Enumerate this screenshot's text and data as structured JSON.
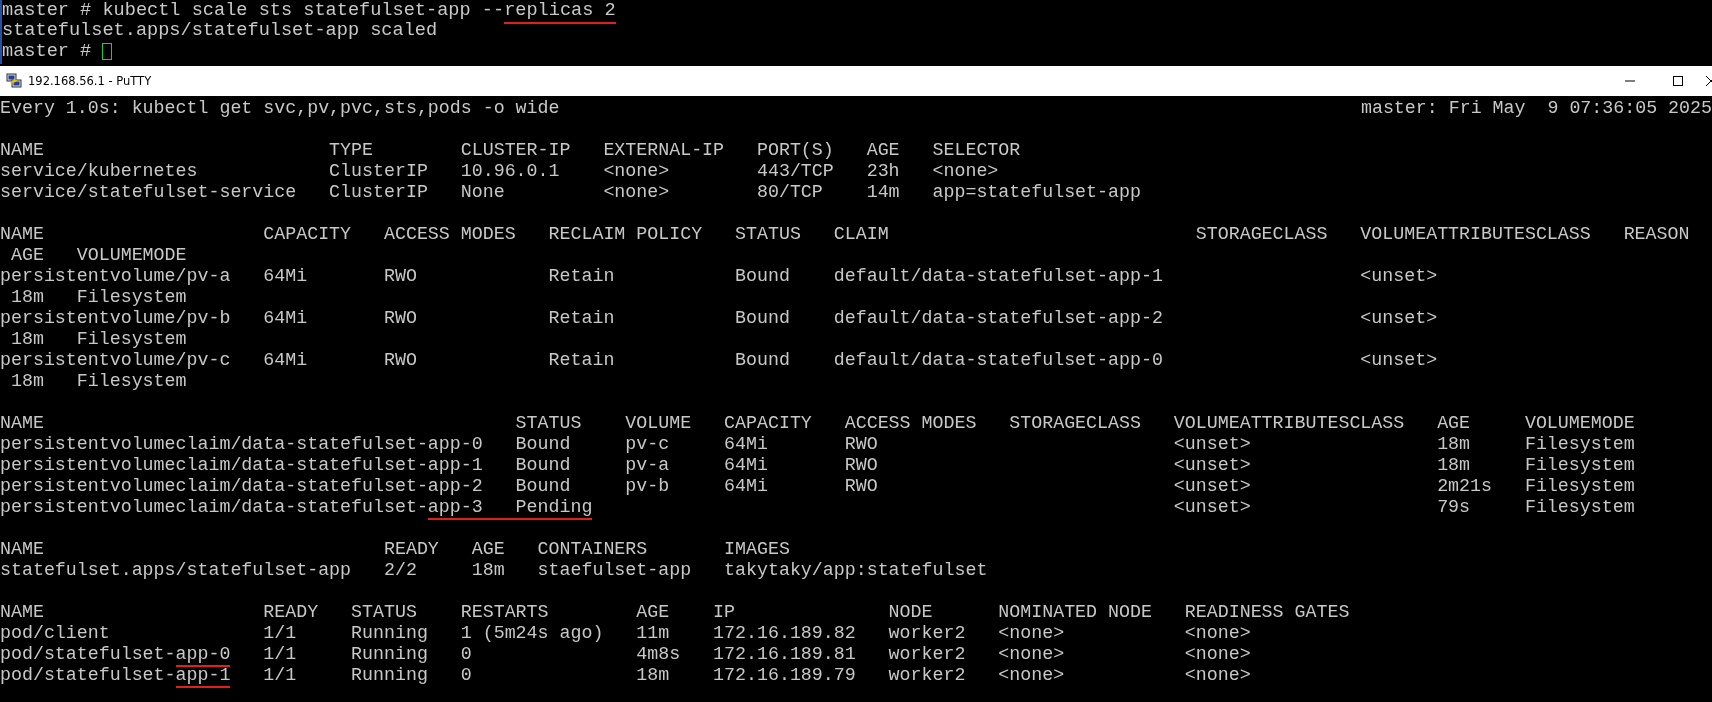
{
  "upper_terminal": {
    "lines": [
      [
        {
          "text": "master # kubectl scale sts statefulset-app --",
          "marked": false
        },
        {
          "text": "replicas 2",
          "marked": true
        }
      ],
      [
        {
          "text": "statefulset.apps/statefulset-app scaled",
          "marked": false
        }
      ],
      [
        {
          "text": "master # ",
          "marked": false
        }
      ]
    ],
    "cursor": true
  },
  "putty_window": {
    "title": "192.168.56.1 - PuTTY",
    "watch_header": {
      "command": "Every 1.0s: kubectl get svc,pv,pvc,sts,pods -o wide",
      "host_time": "master: Fri May  9 07:36:05 2025"
    },
    "blocks": [
      [
        [
          {
            "text": "NAME                          TYPE        CLUSTER-IP   EXTERNAL-IP   PORT(S)   AGE   SELECTOR",
            "marked": false
          }
        ],
        [
          {
            "text": "service/kubernetes            ClusterIP   10.96.0.1    <none>        443/TCP   23h   <none>",
            "marked": false
          }
        ],
        [
          {
            "text": "service/statefulset-service   ClusterIP   None         <none>        80/TCP    14m   app=statefulset-app",
            "marked": false
          }
        ]
      ],
      [
        [
          {
            "text": "NAME                    CAPACITY   ACCESS MODES   RECLAIM POLICY   STATUS   CLAIM                            STORAGECLASS   VOLUMEATTRIBUTESCLASS   REASON",
            "marked": false
          }
        ],
        [
          {
            "text": " AGE   VOLUMEMODE",
            "marked": false
          }
        ],
        [
          {
            "text": "persistentvolume/pv-a   64Mi       RWO            Retain           Bound    default/data-statefulset-app-1                  <unset>",
            "marked": false
          }
        ],
        [
          {
            "text": " 18m   Filesystem",
            "marked": false
          }
        ],
        [
          {
            "text": "persistentvolume/pv-b   64Mi       RWO            Retain           Bound    default/data-statefulset-app-2                  <unset>",
            "marked": false
          }
        ],
        [
          {
            "text": " 18m   Filesystem",
            "marked": false
          }
        ],
        [
          {
            "text": "persistentvolume/pv-c   64Mi       RWO            Retain           Bound    default/data-statefulset-app-0                  <unset>",
            "marked": false
          }
        ],
        [
          {
            "text": " 18m   Filesystem",
            "marked": false
          }
        ]
      ],
      [
        [
          {
            "text": "NAME                                           STATUS    VOLUME   CAPACITY   ACCESS MODES   STORAGECLASS   VOLUMEATTRIBUTESCLASS   AGE     VOLUMEMODE",
            "marked": false
          }
        ],
        [
          {
            "text": "persistentvolumeclaim/data-statefulset-app-0   Bound     pv-c     64Mi       RWO                           <unset>                 18m     Filesystem",
            "marked": false
          }
        ],
        [
          {
            "text": "persistentvolumeclaim/data-statefulset-app-1   Bound     pv-a     64Mi       RWO                           <unset>                 18m     Filesystem",
            "marked": false
          }
        ],
        [
          {
            "text": "persistentvolumeclaim/data-statefulset-app-2   Bound     pv-b     64Mi       RWO                           <unset>                 2m21s   Filesystem",
            "marked": false
          }
        ],
        [
          {
            "text": "persistentvolumeclaim/data-statefulset-",
            "marked": false
          },
          {
            "text": "app-3   Pending",
            "marked": true
          },
          {
            "text": "                                                     <unset>                 79s     Filesystem",
            "marked": false
          }
        ]
      ],
      [
        [
          {
            "text": "NAME                               READY   AGE   CONTAINERS       IMAGES",
            "marked": false
          }
        ],
        [
          {
            "text": "statefulset.apps/statefulset-app   2/2     18m   staefulset-app   takytaky/app:statefulset",
            "marked": false
          }
        ]
      ],
      [
        [
          {
            "text": "NAME                    READY   STATUS    RESTARTS        AGE    IP              NODE      NOMINATED NODE   READINESS GATES",
            "marked": false
          }
        ],
        [
          {
            "text": "pod/client              1/1     Running   1 (5m24s ago)   11m    172.16.189.82   worker2   <none>           <none>",
            "marked": false
          }
        ],
        [
          {
            "text": "pod/statefulset-",
            "marked": false
          },
          {
            "text": "app-0",
            "marked": true
          },
          {
            "text": "   1/1     Running   0               4m8s   172.16.189.81   worker2   <none>           <none>",
            "marked": false
          }
        ],
        [
          {
            "text": "pod/statefulset-",
            "marked": false
          },
          {
            "text": "app-1",
            "marked": true
          },
          {
            "text": "   1/1     Running   0               18m    172.16.189.79   worker2   <none>           <none>",
            "marked": false
          }
        ]
      ]
    ]
  }
}
